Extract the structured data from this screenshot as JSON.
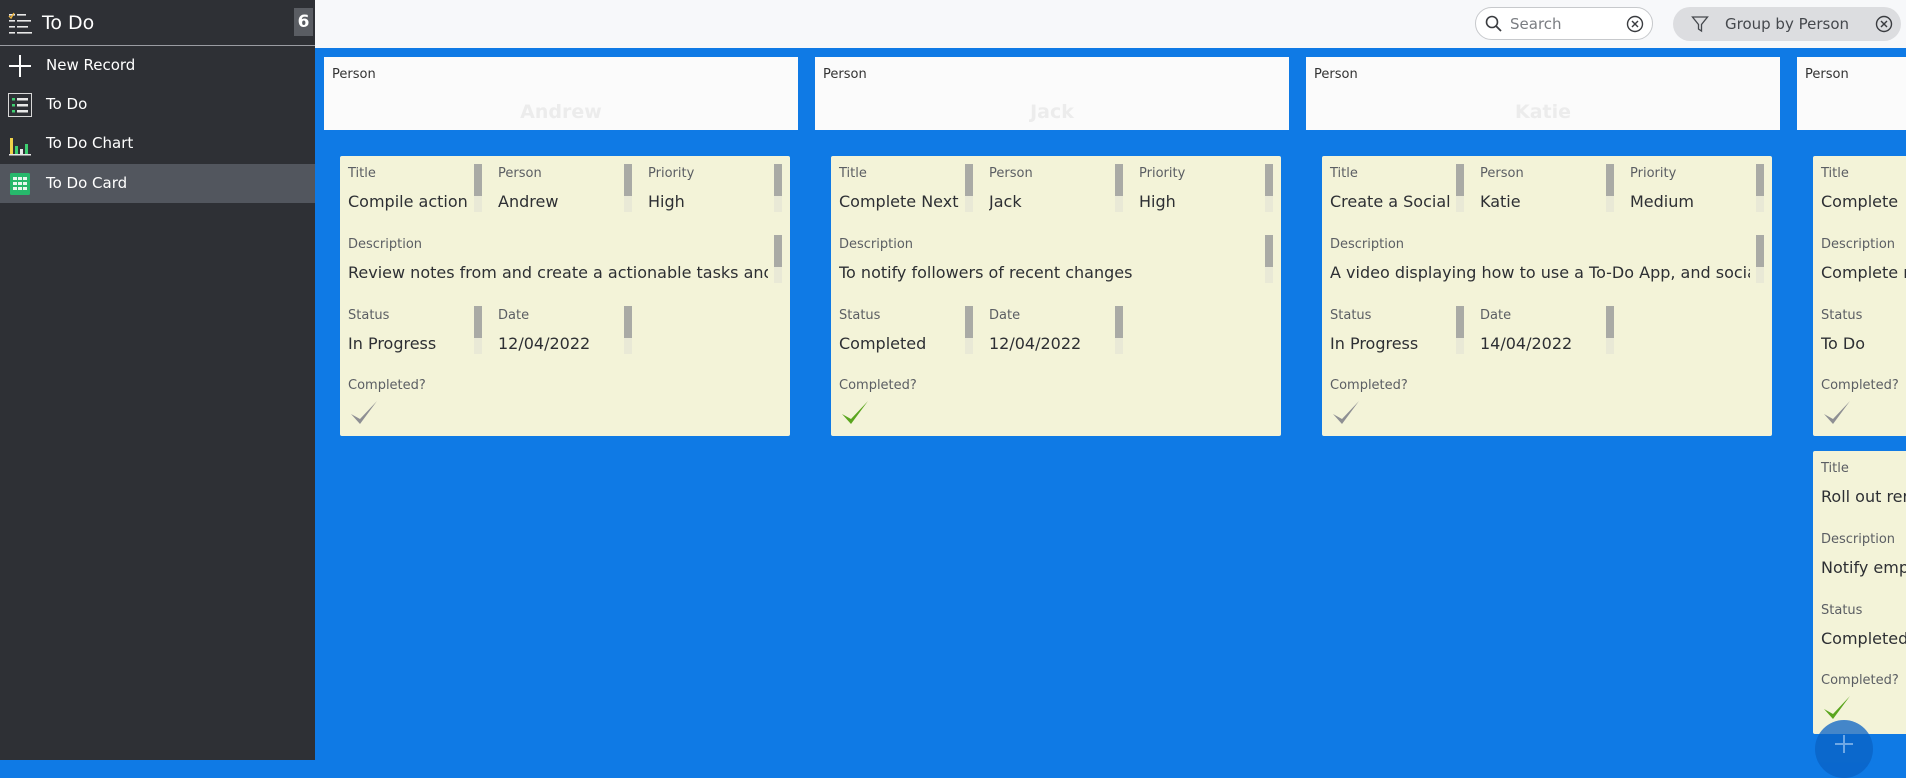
{
  "app": {
    "title": "To Do",
    "badge": "6"
  },
  "sidebar": {
    "items": [
      {
        "label": "New Record",
        "icon": "plus-icon"
      },
      {
        "label": "To Do",
        "icon": "list-icon"
      },
      {
        "label": "To Do Chart",
        "icon": "bar-chart-icon"
      },
      {
        "label": "To Do Card",
        "icon": "card-grid-icon",
        "active": true
      }
    ]
  },
  "toolbar": {
    "search_placeholder": "Search",
    "group_label": "Group by Person"
  },
  "labels": {
    "person": "Person",
    "title": "Title",
    "priority": "Priority",
    "description": "Description",
    "status": "Status",
    "date": "Date",
    "completed": "Completed?"
  },
  "columns": [
    {
      "person": "Andrew",
      "cards": [
        {
          "title": "Compile action",
          "person": "Andrew",
          "priority": "High",
          "description": "Review notes from and create a actionable tasks and",
          "status": "In Progress",
          "date": "12/04/2022",
          "completed": false
        }
      ]
    },
    {
      "person": "Jack",
      "cards": [
        {
          "title": "Complete Next",
          "person": "Jack",
          "priority": "High",
          "description": "To notify followers of recent changes",
          "status": "Completed",
          "date": "12/04/2022",
          "completed": true
        }
      ]
    },
    {
      "person": "Katie",
      "cards": [
        {
          "title": "Create a Social",
          "person": "Katie",
          "priority": "Medium",
          "description": "A video displaying how to use a To-Do App, and social",
          "status": "In Progress",
          "date": "14/04/2022",
          "completed": false
        }
      ]
    },
    {
      "person": "",
      "cards": [
        {
          "title": "Complete",
          "description": "Complete ro",
          "status": "To Do",
          "completed": false
        },
        {
          "title": "Roll out rene",
          "description": "Notify empl",
          "status": "Completed",
          "completed": true
        }
      ]
    }
  ],
  "colors": {
    "board_bg": "#0f7ae5",
    "card_bg": "#f3f3d8",
    "sidebar_bg": "#2e3035",
    "check_done": "#5aa51e",
    "check_pending": "#8e8f93"
  }
}
